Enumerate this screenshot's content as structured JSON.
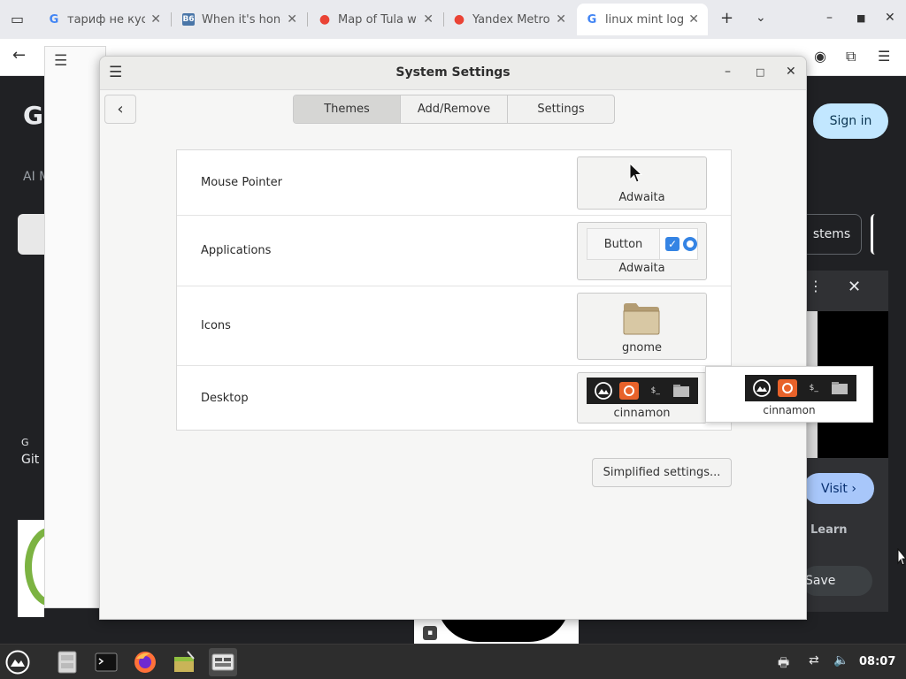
{
  "browser": {
    "tabs": [
      {
        "title": "тариф не куса",
        "favicon": "google-g"
      },
      {
        "title": "When it's hone",
        "favicon": "vk-b6"
      },
      {
        "title": "Map of Tula wit",
        "favicon": "map-pin"
      },
      {
        "title": "Yandex Metro",
        "favicon": "map-pin"
      },
      {
        "title": "linux mint logo",
        "favicon": "google-g"
      }
    ],
    "page": {
      "logo_letter": "G",
      "ai_label": "AI M",
      "signin": "Sign in",
      "systems_chip": "stems",
      "git_small": "G",
      "git_label": "Git",
      "visit": "Visit ›",
      "learn": "Learn",
      "save": "Save"
    }
  },
  "settings": {
    "title": "System Settings",
    "tabs": [
      "Themes",
      "Add/Remove",
      "Settings"
    ],
    "active_tab": "Themes",
    "rows": {
      "mouse_pointer": {
        "label": "Mouse Pointer",
        "value": "Adwaita"
      },
      "applications": {
        "label": "Applications",
        "value": "Adwaita",
        "preview_button": "Button"
      },
      "icons": {
        "label": "Icons",
        "value": "gnome"
      },
      "desktop": {
        "label": "Desktop",
        "value": "cinnamon"
      }
    },
    "simplified_button": "Simplified settings...",
    "popup_value": "cinnamon"
  },
  "taskbar": {
    "clock": "08:07"
  },
  "colors": {
    "accent_blue": "#3584e4",
    "signin_bg": "#c2e7ff",
    "visit_bg": "#a8c7fa",
    "panel_dark": "#202124"
  }
}
